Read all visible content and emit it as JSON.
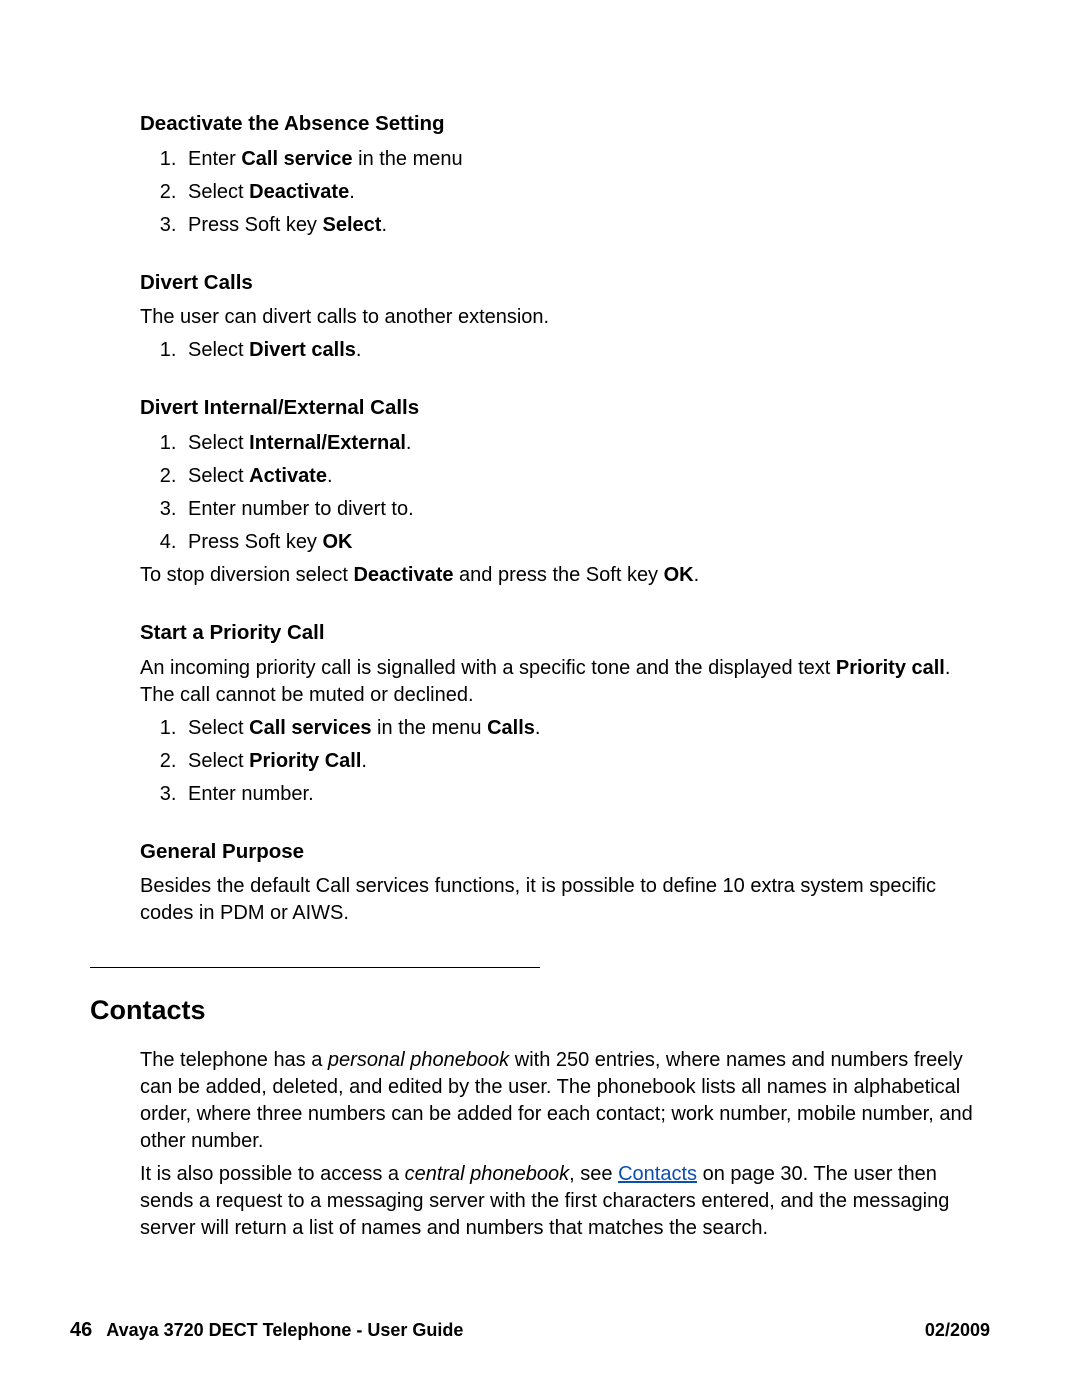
{
  "sec1": {
    "heading": "Deactivate the Absence Setting",
    "step1_a": "Enter ",
    "step1_b": "Call service",
    "step1_c": " in the menu",
    "step2_a": "Select ",
    "step2_b": "Deactivate",
    "step2_c": ".",
    "step3_a": "Press Soft key ",
    "step3_b": "Select",
    "step3_c": "."
  },
  "sec2": {
    "heading": "Divert Calls",
    "intro": "The user can divert calls to another extension.",
    "step1_a": "Select ",
    "step1_b": "Divert calls",
    "step1_c": "."
  },
  "sec3": {
    "heading": "Divert Internal/External Calls",
    "step1_a": "Select ",
    "step1_b": "Internal/External",
    "step1_c": ".",
    "step2_a": "Select ",
    "step2_b": "Activate",
    "step2_c": ".",
    "step3": "Enter number to divert to.",
    "step4_a": "Press Soft key ",
    "step4_b": "OK",
    "after_a": "To stop diversion select ",
    "after_b": "Deactivate",
    "after_c": " and press the Soft key ",
    "after_d": "OK",
    "after_e": "."
  },
  "sec4": {
    "heading": "Start a Priority Call",
    "intro_a": "An incoming priority call is signalled with a specific tone and the displayed text ",
    "intro_b": "Priority call",
    "intro_c": ". The call cannot be muted or declined.",
    "step1_a": "Select ",
    "step1_b": "Call services",
    "step1_c": " in the menu ",
    "step1_d": "Calls",
    "step1_e": ".",
    "step2_a": "Select ",
    "step2_b": "Priority Call",
    "step2_c": ".",
    "step3": "Enter number."
  },
  "sec5": {
    "heading": "General Purpose",
    "body": "Besides the default Call services functions, it is possible to define 10 extra system specific codes in PDM or AIWS."
  },
  "contacts": {
    "heading": "Contacts",
    "p1_a": "The telephone has a ",
    "p1_b": "personal phonebook",
    "p1_c": " with 250 entries, where names and numbers freely can be added, deleted, and edited by the user. The phonebook lists all names in alphabetical order, where three numbers can be added for each contact; work number, mobile number, and other number.",
    "p2_a": "It is also possible to access a ",
    "p2_b": "central phonebook",
    "p2_c": ", see ",
    "p2_link": "Contacts",
    "p2_d": " on page 30. The user then sends a request to a messaging server with the first characters entered, and the messaging server will return a list of names and numbers that matches the search."
  },
  "footer": {
    "page_number": "46",
    "doc_title": "Avaya 3720 DECT Telephone - User Guide",
    "date": "02/2009"
  }
}
